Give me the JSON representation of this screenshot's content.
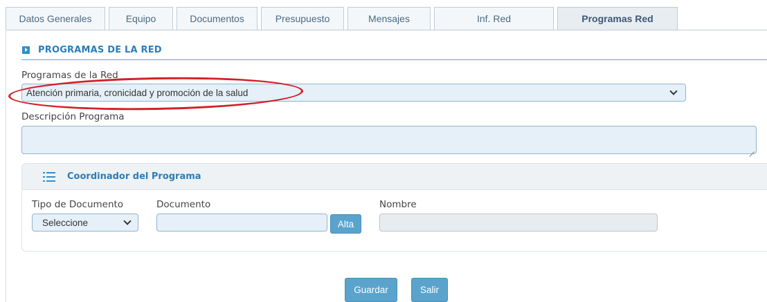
{
  "tabs": [
    {
      "label": "Datos Generales",
      "active": false
    },
    {
      "label": "Equipo",
      "active": false
    },
    {
      "label": "Documentos",
      "active": false
    },
    {
      "label": "Presupuesto",
      "active": false
    },
    {
      "label": "Mensajes",
      "active": false
    },
    {
      "label": "Inf. Red",
      "active": false
    },
    {
      "label": "Programas Red",
      "active": true
    }
  ],
  "section": {
    "title": "PROGRAMAS DE LA RED",
    "icon": "play-square-icon"
  },
  "programas": {
    "label": "Programas de la Red",
    "selected": "Atención primaria, cronicidad y promoción de la salud"
  },
  "descripcion": {
    "label": "Descripción Programa",
    "value": ""
  },
  "coordinador": {
    "title": "Coordinador del Programa",
    "icon": "list-icon",
    "tipo_label": "Tipo de Documento",
    "tipo_selected": "Seleccione",
    "documento_label": "Documento",
    "documento_value": "",
    "alta_label": "Alta",
    "nombre_label": "Nombre",
    "nombre_value": ""
  },
  "actions": {
    "guardar": "Guardar",
    "salir": "Salir"
  },
  "colors": {
    "accent": "#2a7db8",
    "button": "#5aa3cc",
    "field_bg": "#e6f0f8",
    "highlight": "#d31f28"
  }
}
